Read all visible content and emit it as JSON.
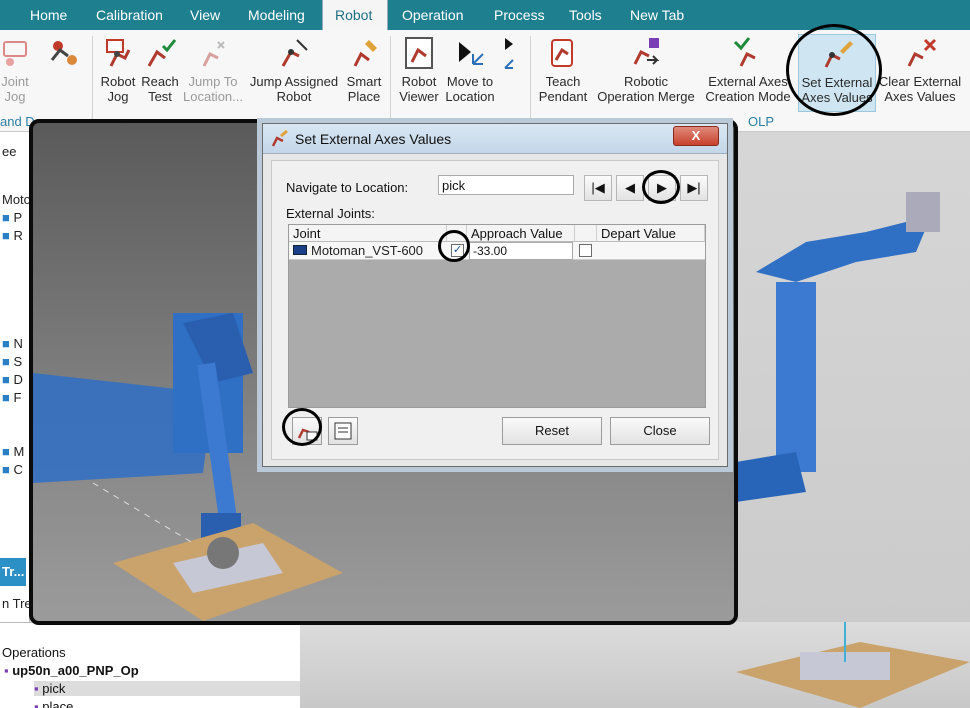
{
  "tabs": [
    "Home",
    "Calibration",
    "View",
    "Modeling",
    "Robot",
    "Operation",
    "Process",
    "Tools",
    "New Tab"
  ],
  "active_tab": "Robot",
  "ribbon": {
    "partial_left": {
      "line1": "Joint",
      "line2": "Jog"
    },
    "robot_jog": {
      "line1": "Robot",
      "line2": "Jog"
    },
    "reach_test": {
      "line1": "Reach",
      "line2": "Test"
    },
    "jump_to_location": {
      "line1": "Jump To",
      "line2": "Location..."
    },
    "jump_assigned_robot": {
      "line1": "Jump Assigned",
      "line2": "Robot"
    },
    "smart_place": {
      "line1": "Smart",
      "line2": "Place"
    },
    "robot_viewer": {
      "line1": "Robot",
      "line2": "Viewer"
    },
    "move_to_location": {
      "line1": "Move to",
      "line2": "Location"
    },
    "teach_pendant": {
      "line1": "Teach",
      "line2": "Pendant"
    },
    "robotic_operation_merge": {
      "line1": "Robotic",
      "line2": "Operation Merge"
    },
    "external_axes_creation_mode": {
      "line1": "External Axes",
      "line2": "Creation Mode"
    },
    "set_external_axes_values": {
      "line1": "Set External",
      "line2": "Axes Values"
    },
    "clear_external_axes_values": {
      "line1": "Clear External",
      "line2": "Axes Values"
    },
    "group_left": "and De",
    "group_olp": "OLP"
  },
  "left_panel": {
    "header": "ee",
    "items": [
      "Moto",
      "P",
      "R",
      "",
      "",
      "",
      "",
      "",
      "N",
      "S",
      "D",
      "F",
      "",
      "",
      "M",
      "C"
    ],
    "blue_tab": "Tr...",
    "bottom_label": "n Tre"
  },
  "operations_tree": {
    "header": "Operations",
    "root": "up50n_a00_PNP_Op",
    "children": [
      "pick",
      "place"
    ],
    "selected": "pick"
  },
  "dialog": {
    "title": "Set External Axes Values",
    "close_glyph": "X",
    "navigate_label": "Navigate to Location:",
    "navigate_value": "pick",
    "nav_first": "|◀",
    "nav_prev": "◀",
    "nav_next": "▶",
    "nav_last": "▶|",
    "external_joints_label": "External Joints:",
    "columns": [
      "Joint",
      "Approach Value",
      "Depart Value"
    ],
    "rows": [
      {
        "joint": "Motoman_VST-600",
        "approach_checked": true,
        "approach_value": "-33.00",
        "depart_checked": false,
        "depart_value": ""
      }
    ],
    "reset_label": "Reset",
    "close_label": "Close"
  },
  "colors": {
    "tabbar": "#1e7f8f",
    "robot_blue": "#2f6fc4",
    "highlight": "#cfe6f2",
    "group_label": "#2b7fa5"
  }
}
